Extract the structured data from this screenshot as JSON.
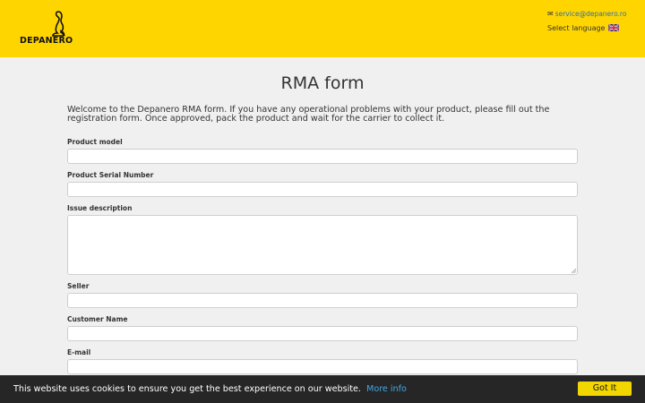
{
  "header": {
    "logo_text": "DEPANERO",
    "email": "service@depanero.ro",
    "select_language": "Select language",
    "language_flag": "uk-flag-icon",
    "background_color": "#ffd500"
  },
  "main": {
    "title": "RMA form",
    "intro": "Welcome to the Depanero RMA form. If you have any operational problems with your product, please fill out the registration form. Once approved, pack the product and wait for the carrier to collect it.",
    "fields": {
      "product_model": {
        "label": "Product model",
        "value": ""
      },
      "serial_number": {
        "label": "Product Serial Number",
        "value": ""
      },
      "issue_description": {
        "label": "Issue description",
        "value": ""
      },
      "seller": {
        "label": "Seller",
        "value": ""
      },
      "customer_name": {
        "label": "Customer Name",
        "value": ""
      },
      "email": {
        "label": "E-mail",
        "value": ""
      }
    }
  },
  "cookie_bar": {
    "message": "This website uses cookies to ensure you get the best experience on our website.",
    "more_info": "More info",
    "button": "Got It",
    "link_color": "#41a7e8",
    "button_color": "#f1d600"
  }
}
